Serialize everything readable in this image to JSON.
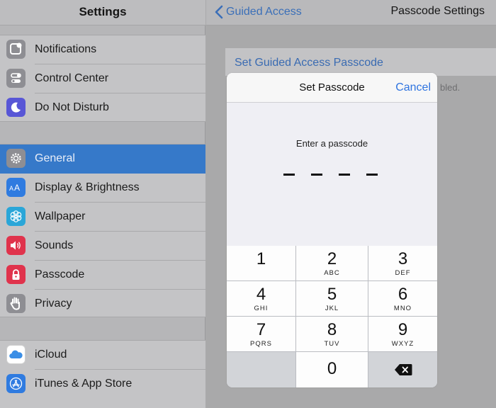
{
  "sidebar": {
    "title": "Settings",
    "items": [
      {
        "label": "Notifications",
        "icon": "notifications-icon",
        "color": "#8e8e93"
      },
      {
        "label": "Control Center",
        "icon": "control-center-icon",
        "color": "#8e8e93"
      },
      {
        "label": "Do Not Disturb",
        "icon": "moon-icon",
        "color": "#5856d6"
      },
      {
        "label": "General",
        "icon": "gear-icon",
        "color": "#8e8e93",
        "selected": true
      },
      {
        "label": "Display & Brightness",
        "icon": "display-brightness-icon",
        "color": "#2f7be0"
      },
      {
        "label": "Wallpaper",
        "icon": "wallpaper-icon",
        "color": "#2aa6d8"
      },
      {
        "label": "Sounds",
        "icon": "speaker-icon",
        "color": "#e0334c"
      },
      {
        "label": "Passcode",
        "icon": "lock-icon",
        "color": "#e0334c"
      },
      {
        "label": "Privacy",
        "icon": "hand-icon",
        "color": "#8e8e93"
      },
      {
        "label": "iCloud",
        "icon": "cloud-icon",
        "color": "#ffffff"
      },
      {
        "label": "iTunes & App Store",
        "icon": "app-store-icon",
        "color": "#2f7be0"
      }
    ]
  },
  "detail": {
    "back_label": "Guided Access",
    "title": "Passcode Settings",
    "row_label": "Set Guided Access Passcode",
    "footer_text": "bled."
  },
  "modal": {
    "title": "Set Passcode",
    "cancel": "Cancel",
    "prompt": "Enter a passcode",
    "digits_entered": 0,
    "digits_total": 4,
    "keys": [
      {
        "num": "1",
        "letters": ""
      },
      {
        "num": "2",
        "letters": "ABC"
      },
      {
        "num": "3",
        "letters": "DEF"
      },
      {
        "num": "4",
        "letters": "GHI"
      },
      {
        "num": "5",
        "letters": "JKL"
      },
      {
        "num": "6",
        "letters": "MNO"
      },
      {
        "num": "7",
        "letters": "PQRS"
      },
      {
        "num": "8",
        "letters": "TUV"
      },
      {
        "num": "9",
        "letters": "WXYZ"
      },
      {
        "num": "0",
        "letters": ""
      }
    ],
    "delete_icon": "backspace-icon"
  },
  "colors": {
    "accent": "#3679c9",
    "link": "#2f74e0"
  }
}
